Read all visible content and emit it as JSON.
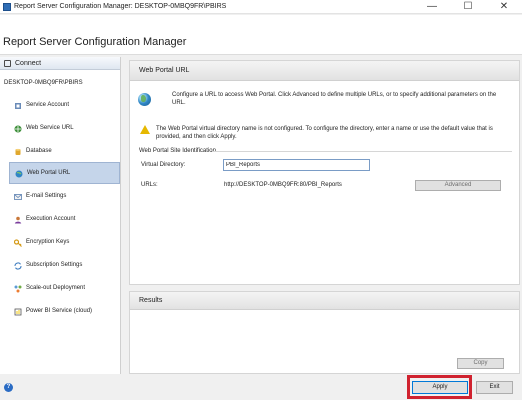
{
  "window": {
    "title": "Report Server Configuration Manager: DESKTOP-0MBQ9FR\\PBIRS",
    "minimize_glyph": "—",
    "maximize_glyph": "☐",
    "close_glyph": "✕"
  },
  "header": {
    "title": "Report Server Configuration Manager"
  },
  "sidebar": {
    "connect_label": "Connect",
    "server": "DESKTOP-0MBQ9FR\\PBIRS",
    "items": [
      {
        "label": "Service Account",
        "icon": "service-account-icon"
      },
      {
        "label": "Web Service URL",
        "icon": "web-service-icon"
      },
      {
        "label": "Database",
        "icon": "database-icon"
      },
      {
        "label": "Web Portal URL",
        "icon": "web-portal-icon",
        "active": true
      },
      {
        "label": "E-mail Settings",
        "icon": "email-icon"
      },
      {
        "label": "Execution Account",
        "icon": "execution-account-icon"
      },
      {
        "label": "Encryption Keys",
        "icon": "key-icon"
      },
      {
        "label": "Subscription Settings",
        "icon": "subscription-icon"
      },
      {
        "label": "Scale-out Deployment",
        "icon": "scale-out-icon"
      },
      {
        "label": "Power BI Service (cloud)",
        "icon": "power-bi-icon"
      }
    ]
  },
  "main": {
    "title": "Web Portal URL",
    "intro": "Configure a URL to access Web Portal.  Click Advanced to define multiple URLs, or to specify additional parameters on the URL.",
    "warning": "The Web Portal virtual directory name is not configured. To configure the directory, enter a name or use the default value that is provided, and then click Apply.",
    "group_title": "Web Portal Site Identification",
    "virtual_directory_label": "Virtual Directory:",
    "virtual_directory_value": "PBI_Reports",
    "urls_label": "URLs:",
    "urls_value": "http://DESKTOP-0MBQ9FR:80/PBI_Reports",
    "advanced_label": "Advanced"
  },
  "results": {
    "title": "Results",
    "copy_label": "Copy"
  },
  "footer": {
    "help_glyph": "?",
    "apply_label": "Apply",
    "exit_label": "Exit"
  },
  "colors": {
    "highlight": "#d0222f",
    "active_nav": "#c5d5ea",
    "accent": "#0078d7"
  }
}
